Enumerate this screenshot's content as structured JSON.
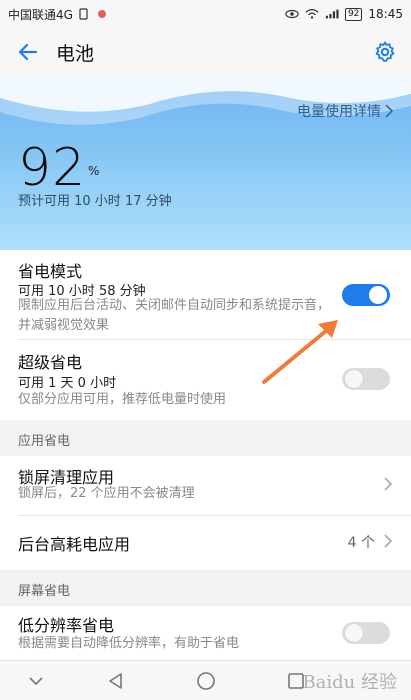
{
  "status_bar": {
    "carrier": "中国联通4G",
    "battery": "92",
    "time": "18:45"
  },
  "app_bar": {
    "title": "电池"
  },
  "hero": {
    "detail_link": "电量使用详情",
    "percent": "92",
    "percent_sign": "%",
    "estimate": "预计可用 10 小时 17 分钟"
  },
  "power_saving": {
    "title": "省电模式",
    "available": "可用 10 小时 58 分钟",
    "description": "限制应用后台活动、关闭邮件自动同步和系统提示音，并减弱视觉效果",
    "enabled": true
  },
  "ultra_saving": {
    "title": "超级省电",
    "available": "可用 1 天 0 小时",
    "description": "仅部分应用可用，推荐低电量时使用",
    "enabled": false
  },
  "section_app": "应用省电",
  "lockscreen_clean": {
    "title": "锁屏清理应用",
    "description": "锁屏后，22 个应用不会被清理"
  },
  "background_heavy": {
    "title": "后台高耗电应用",
    "count": "4 个"
  },
  "section_screen": "屏幕省电",
  "low_resolution": {
    "title": "低分辨率省电",
    "description": "根据需要自动降低分辨率，有助于省电",
    "enabled": false
  },
  "colors": {
    "accent": "#1f7ce8",
    "hero_top": "#6fb2f2",
    "hero_bottom": "#aee0f8",
    "arrow": "#f07a3a"
  },
  "watermark": "Baidu 经验"
}
